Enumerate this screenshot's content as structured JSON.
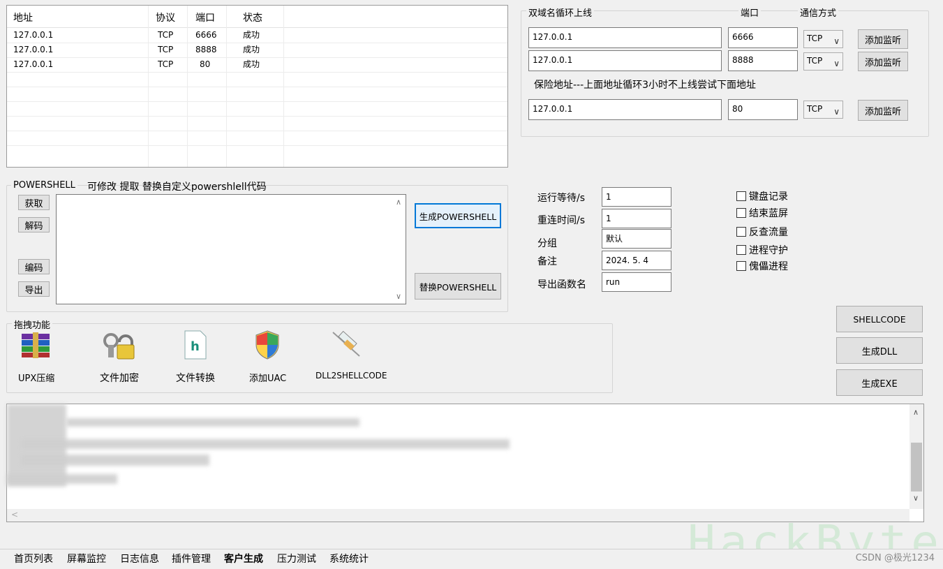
{
  "addr_table": {
    "headers": [
      "地址",
      "协议",
      "端口",
      "状态"
    ],
    "rows": [
      {
        "addr": "127.0.0.1",
        "proto": "TCP",
        "port": "6666",
        "status": "成功"
      },
      {
        "addr": "127.0.0.1",
        "proto": "TCP",
        "port": "8888",
        "status": "成功"
      },
      {
        "addr": "127.0.0.1",
        "proto": "TCP",
        "port": "80",
        "status": "成功"
      }
    ]
  },
  "domain_group": {
    "title": "双域名循环上线",
    "port_header": "端口",
    "comm_header": "通信方式",
    "rows": [
      {
        "addr": "127.0.0.1",
        "port": "6666",
        "proto": "TCP",
        "btn": "添加监听"
      },
      {
        "addr": "127.0.0.1",
        "port": "8888",
        "proto": "TCP",
        "btn": "添加监听"
      }
    ],
    "backup_label": "保险地址---上面地址循环3小时不上线尝试下面地址",
    "backup_row": {
      "addr": "127.0.0.1",
      "port": "80",
      "proto": "TCP",
      "btn": "添加监听"
    }
  },
  "powershell": {
    "legend": "POWERSHELL",
    "hint": "可修改 提取 替换自定义powershlell代码",
    "btn_get": "获取",
    "btn_decode": "解码",
    "btn_encode": "编码",
    "btn_export": "导出",
    "btn_generate": "生成POWERSHELL",
    "btn_replace": "替换POWERSHELL"
  },
  "settings": {
    "wait_label": "运行等待/s",
    "wait_value": "1",
    "reconnect_label": "重连时间/s",
    "reconnect_value": "1",
    "group_label": "分组",
    "group_value": "默认",
    "note_label": "备注",
    "note_value": "2024. 5. 4",
    "export_label": "导出函数名",
    "export_value": "run"
  },
  "checks": [
    "键盘记录",
    "结束蓝屏",
    "反查流量",
    "进程守护",
    "傀儡进程"
  ],
  "drag": {
    "legend": "拖拽功能",
    "tools": [
      {
        "label": "UPX压缩",
        "icon": "archive-icon"
      },
      {
        "label": "文件加密",
        "icon": "lock-key-icon"
      },
      {
        "label": "文件转换",
        "icon": "file-h-icon"
      },
      {
        "label": "添加UAC",
        "icon": "shield-icon"
      },
      {
        "label": "DLL2SHELLCODE",
        "icon": "syringe-icon"
      }
    ]
  },
  "actions": {
    "shellcode": "SHELLCODE",
    "gen_dll": "生成DLL",
    "gen_exe": "生成EXE"
  },
  "tabs": [
    "首页列表",
    "屏幕监控",
    "日志信息",
    "插件管理",
    "客户生成",
    "压力测试",
    "系统统计"
  ],
  "active_tab": "客户生成",
  "watermark": "CSDN @极光1234",
  "brand_watermark": "HackByte"
}
